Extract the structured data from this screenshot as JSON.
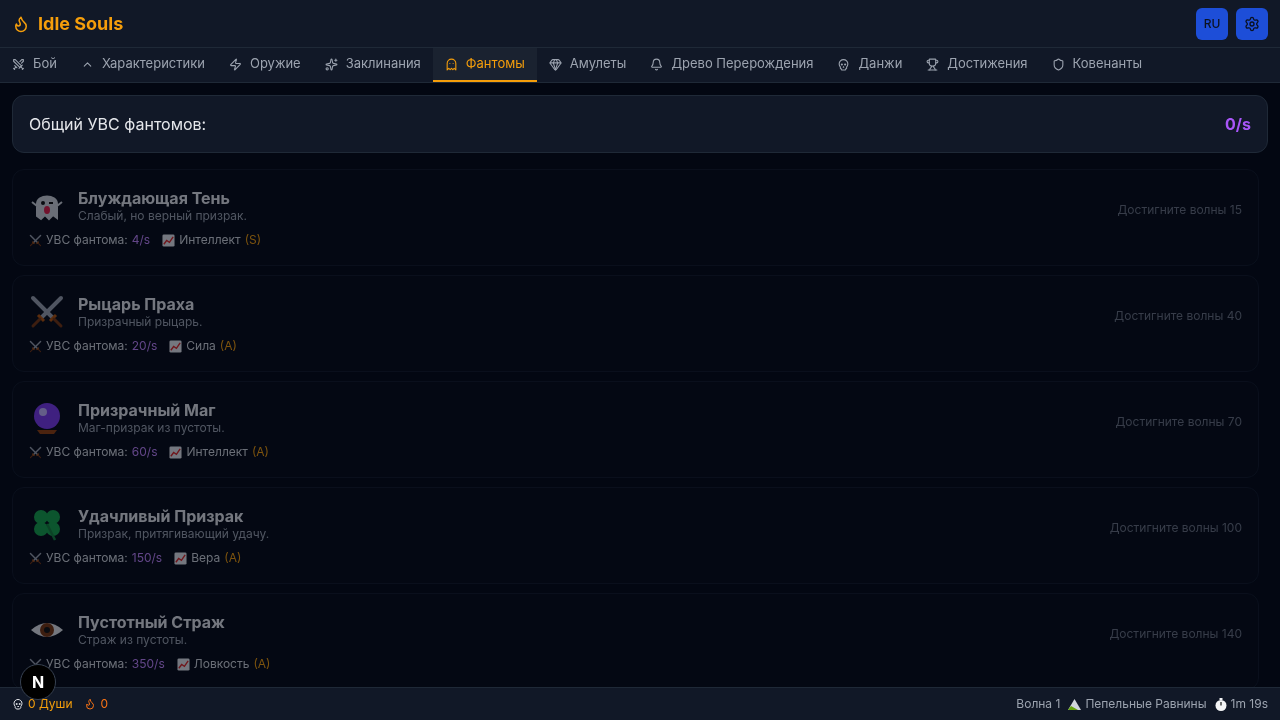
{
  "header": {
    "title": "Idle Souls",
    "language_button": "RU"
  },
  "tabs": [
    {
      "label": "Бой",
      "selected": false
    },
    {
      "label": "Характеристики",
      "selected": false
    },
    {
      "label": "Оружие",
      "selected": false
    },
    {
      "label": "Заклинания",
      "selected": false
    },
    {
      "label": "Фантомы",
      "selected": true
    },
    {
      "label": "Амулеты",
      "selected": false
    },
    {
      "label": "Древо Перерождения",
      "selected": false
    },
    {
      "label": "Данжи",
      "selected": false
    },
    {
      "label": "Достижения",
      "selected": false
    },
    {
      "label": "Ковенанты",
      "selected": false
    }
  ],
  "total": {
    "label": "Общий УВС фантомов:",
    "value": "0/s"
  },
  "phantoms": [
    {
      "kind": "ghost",
      "name": "Блуждающая Тень",
      "description": "Слабый, но верный призрак.",
      "dps_label": "УВС фантома:",
      "dps": "4/s",
      "attribute": "Интеллект",
      "grade": "(S)",
      "requirement": "Достигните волны 15",
      "locked": true
    },
    {
      "kind": "swords",
      "name": "Рыцарь Праха",
      "description": "Призрачный рыцарь.",
      "dps_label": "УВС фантома:",
      "dps": "20/s",
      "attribute": "Сила",
      "grade": "(A)",
      "requirement": "Достигните волны 40",
      "locked": true
    },
    {
      "kind": "orb",
      "name": "Призрачный Маг",
      "description": "Маг-призрак из пустоты.",
      "dps_label": "УВС фантома:",
      "dps": "60/s",
      "attribute": "Интеллект",
      "grade": "(A)",
      "requirement": "Достигните волны 70",
      "locked": true
    },
    {
      "kind": "clover",
      "name": "Удачливый Призрак",
      "description": "Призрак, притягивающий удачу.",
      "dps_label": "УВС фантома:",
      "dps": "150/s",
      "attribute": "Вера",
      "grade": "(A)",
      "requirement": "Достигните волны 100",
      "locked": true
    },
    {
      "kind": "eye",
      "name": "Пустотный Страж",
      "description": "Страж из пустоты.",
      "dps_label": "УВС фантома:",
      "dps": "350/s",
      "attribute": "Ловкость",
      "grade": "(A)",
      "requirement": "Достигните волны 140",
      "locked": true
    }
  ],
  "dev_badge": "N",
  "status_bar": {
    "souls": "0 Души",
    "embers": "0",
    "wave": "Волна 1",
    "location": "Пепельные Равнины",
    "time": "1m 19s"
  }
}
